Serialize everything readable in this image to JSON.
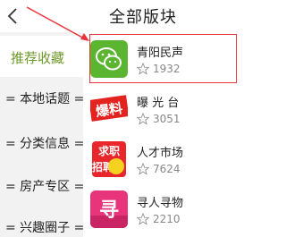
{
  "header": {
    "title": "全部版块"
  },
  "sidebar": {
    "items": [
      {
        "label": "推荐收藏"
      },
      {
        "label": "= 本地话题 ="
      },
      {
        "label": "= 分类信息 ="
      },
      {
        "label": "= 房产专区 ="
      },
      {
        "label": "= 兴趣圈子 ="
      }
    ]
  },
  "boards": [
    {
      "name": "青阳民声",
      "count": "1932",
      "icon": "wechat-icon"
    },
    {
      "name": "曝 光 台",
      "count": "3051",
      "icon": "baoliao-icon",
      "icon_text": "爆料"
    },
    {
      "name": "人才市场",
      "count": "7624",
      "icon": "recruitment-icon",
      "icon_text_top": "求职",
      "icon_text_bottom": "招聘"
    },
    {
      "name": "寻人寻物",
      "count": "2210",
      "icon": "lost-found-icon",
      "icon_text": "寻"
    }
  ],
  "colors": {
    "accent": "#6e9a2a",
    "highlight": "#e8343a"
  }
}
